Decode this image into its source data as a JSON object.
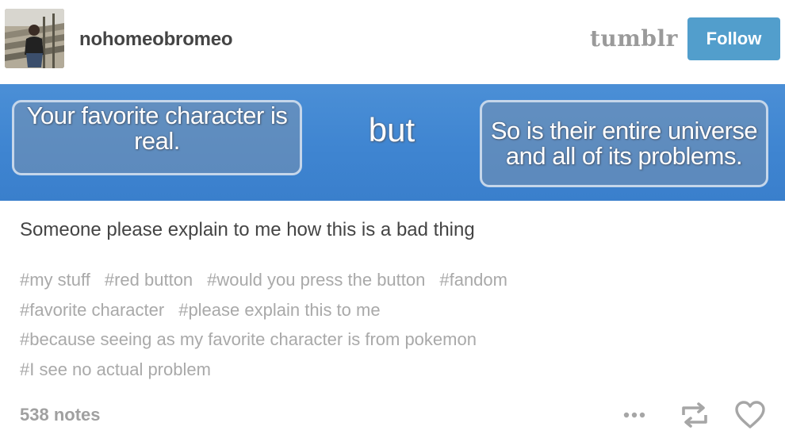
{
  "header": {
    "username": "nohomeobromeo",
    "logo": "tumblr",
    "follow_label": "Follow",
    "accent_color": "#529ecc"
  },
  "image": {
    "left_button_text": "Your favorite character is real.",
    "middle_text": "but",
    "right_button_text": "So is their entire universe and all of its problems.",
    "background_color": "#4287d3"
  },
  "post": {
    "caption": "Someone please explain to me how this is a bad thing",
    "tag_lines": [
      [
        "#my stuff",
        "#red button",
        "#would you press the button",
        "#fandom"
      ],
      [
        "#favorite character",
        "#please explain this to me"
      ],
      [
        "#because seeing as my favorite character is from pokemon"
      ],
      [
        "#I see no actual problem"
      ]
    ]
  },
  "footer": {
    "notes": "538 notes",
    "icons": [
      "more-icon",
      "reblog-icon",
      "heart-icon"
    ]
  }
}
